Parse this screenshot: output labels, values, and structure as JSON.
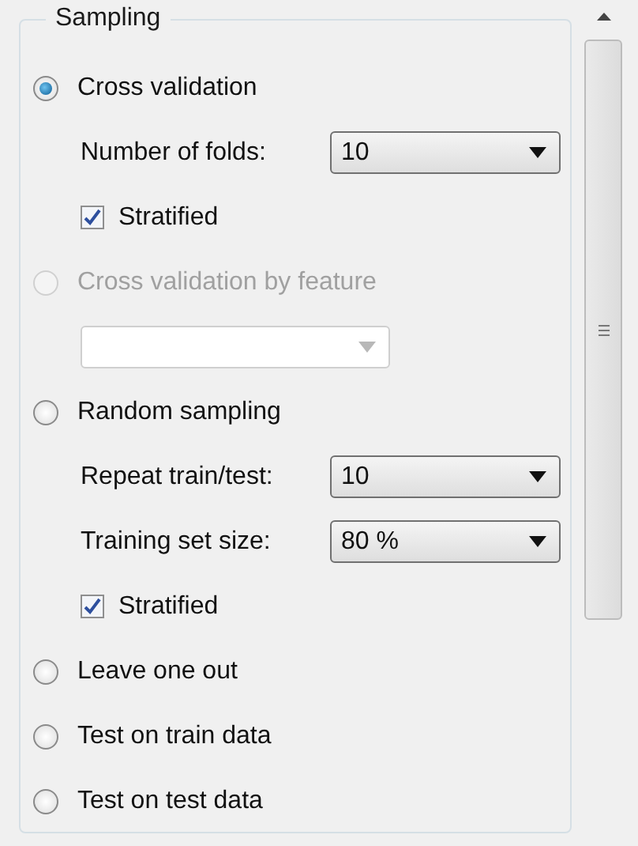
{
  "group": {
    "title": "Sampling"
  },
  "options": [
    {
      "label": "Cross validation",
      "selected": true,
      "disabled": false,
      "settings": [
        {
          "kind": "select",
          "label": "Number of folds:",
          "value": "10"
        },
        {
          "kind": "checkbox",
          "label": "Stratified",
          "checked": true
        }
      ]
    },
    {
      "label": "Cross validation by feature",
      "selected": false,
      "disabled": true,
      "settings": [
        {
          "kind": "select",
          "disabled": true
        }
      ]
    },
    {
      "label": "Random sampling",
      "selected": false,
      "disabled": false,
      "settings": [
        {
          "kind": "select",
          "label": "Repeat train/test:",
          "value": "10"
        },
        {
          "kind": "select",
          "label": "Training set size:",
          "value": "80 %"
        },
        {
          "kind": "checkbox",
          "label": "Stratified",
          "checked": true
        }
      ]
    },
    {
      "label": "Leave one out",
      "selected": false,
      "disabled": false
    },
    {
      "label": "Test on train data",
      "selected": false,
      "disabled": false
    },
    {
      "label": "Test on test data",
      "selected": false,
      "disabled": false
    }
  ]
}
